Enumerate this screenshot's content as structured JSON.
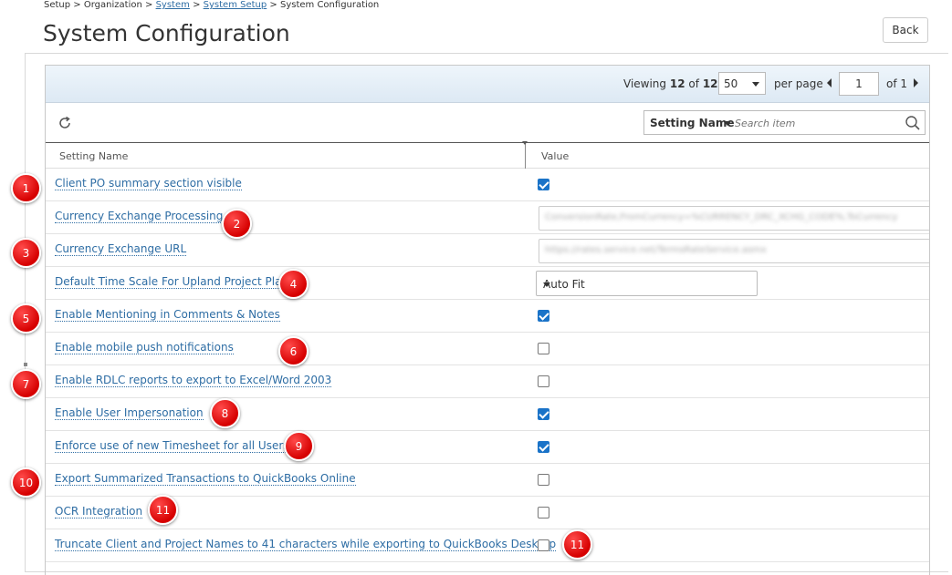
{
  "breadcrumb": {
    "items": [
      {
        "label": "Setup",
        "link": false
      },
      {
        "label": "Organization",
        "link": false
      },
      {
        "label": "System",
        "link": true
      },
      {
        "label": "System Setup",
        "link": true
      },
      {
        "label": "System Configuration",
        "link": false
      }
    ],
    "separator": ">"
  },
  "page_title": "System Configuration",
  "back_label": "Back",
  "pager": {
    "viewing_label": "Viewing",
    "viewing_count": "12",
    "of_label": "of",
    "viewing_total": "12",
    "page_size": "50",
    "per_page_label": "per page",
    "page_number": "1",
    "page_total_label": "of 1"
  },
  "search": {
    "field_label": "Setting Name",
    "placeholder": "Search item"
  },
  "columns": {
    "name": "Setting Name",
    "value": "Value"
  },
  "rows": [
    {
      "name": "Client PO summary section visible",
      "type": "checkbox",
      "checked": true
    },
    {
      "name": "Currency Exchange Processing",
      "type": "text",
      "value": "ConversionRate,FromCurrency=%CURRENCY_DRC_XCHG_CODE%,ToCurrency"
    },
    {
      "name": "Currency Exchange URL",
      "type": "text",
      "value": "https://rates.service.net/TermsRateService.asmx"
    },
    {
      "name": "Default Time Scale For Upland Project Planner",
      "type": "select",
      "value": "Auto Fit"
    },
    {
      "name": "Enable Mentioning in Comments & Notes",
      "type": "checkbox",
      "checked": true
    },
    {
      "name": "Enable mobile push notifications",
      "type": "checkbox",
      "checked": false
    },
    {
      "name": "Enable RDLC reports to export to Excel/Word 2003",
      "type": "checkbox",
      "checked": false
    },
    {
      "name": "Enable User Impersonation",
      "type": "checkbox",
      "checked": true
    },
    {
      "name": "Enforce use of new Timesheet for all Users",
      "type": "checkbox",
      "checked": true
    },
    {
      "name": "Export Summarized Transactions to QuickBooks Online",
      "type": "checkbox",
      "checked": false
    },
    {
      "name": "OCR Integration",
      "type": "checkbox",
      "checked": false
    },
    {
      "name": "Truncate Client and Project Names to 41 characters while exporting to QuickBooks Desktop",
      "type": "checkbox",
      "checked": false
    }
  ],
  "callouts": [
    "1",
    "2",
    "3",
    "4",
    "5",
    "6",
    "7",
    "8",
    "9",
    "10",
    "11",
    "11"
  ],
  "colors": {
    "link": "#2e6da4",
    "callout": "#d60000",
    "checkbox_checked": "#1a73c8"
  }
}
